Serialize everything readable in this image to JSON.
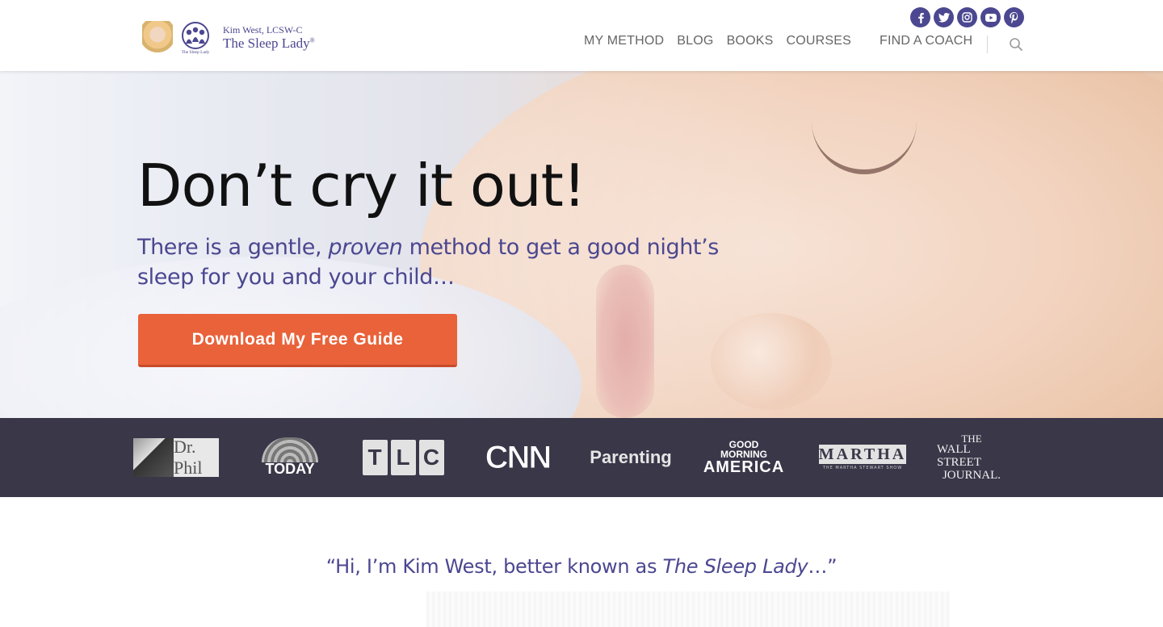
{
  "brand": {
    "subtitle": "Kim West, LCSW-C",
    "name": "The Sleep Lady",
    "mark": "®",
    "logo_small_text": "The Sleep Lady",
    "accent_color": "#4b4790"
  },
  "social": [
    {
      "icon": "facebook-icon",
      "glyph": "f"
    },
    {
      "icon": "twitter-icon",
      "glyph": "t"
    },
    {
      "icon": "instagram-icon",
      "glyph": "◎"
    },
    {
      "icon": "youtube-icon",
      "glyph": "▶"
    },
    {
      "icon": "pinterest-icon",
      "glyph": "p"
    }
  ],
  "nav": {
    "items": [
      "MY METHOD",
      "BLOG",
      "BOOKS",
      "COURSES",
      "FIND A COACH"
    ]
  },
  "hero": {
    "title": "Don’t cry it out!",
    "sub_before": "There is a gentle, ",
    "sub_em": "proven",
    "sub_after": " method to get a good night’s sleep for you and your child…",
    "cta": "Download My Free Guide",
    "cta_color": "#e9623a"
  },
  "press": {
    "phil": "Dr. Phil",
    "today": "TODAY",
    "tlc": [
      "T",
      "L",
      "C"
    ],
    "cnn": "CNN",
    "parenting": "Parenting",
    "gma": [
      "GOOD",
      "MORNING",
      "AMERICA"
    ],
    "martha": "MARTHA",
    "martha_sub": "THE MARTHA STEWART SHOW",
    "wsj": [
      "THE",
      "WALL STREET",
      "JOURNAL."
    ]
  },
  "intro": {
    "before": "“Hi, I’m Kim West, better known as ",
    "em": "The Sleep Lady",
    "after": "…”"
  }
}
